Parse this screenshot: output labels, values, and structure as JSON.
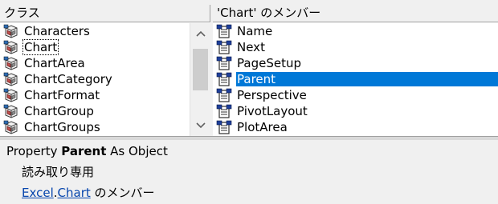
{
  "classes_pane": {
    "header": "クラス",
    "items": [
      {
        "label": "Characters"
      },
      {
        "label": "Chart"
      },
      {
        "label": "ChartArea"
      },
      {
        "label": "ChartCategory"
      },
      {
        "label": "ChartFormat"
      },
      {
        "label": "ChartGroup"
      },
      {
        "label": "ChartGroups"
      }
    ],
    "focused_index": 1
  },
  "members_pane": {
    "header": "'Chart' のメンバー",
    "items": [
      {
        "label": "Name"
      },
      {
        "label": "Next"
      },
      {
        "label": "PageSetup"
      },
      {
        "label": "Parent"
      },
      {
        "label": "Perspective"
      },
      {
        "label": "PivotLayout"
      },
      {
        "label": "PlotArea"
      }
    ],
    "selected_index": 3
  },
  "details": {
    "prefix": "Property ",
    "member_name": "Parent",
    "suffix": " As Object",
    "readonly_note": "読み取り専用",
    "library_link": "Excel",
    "dot": ".",
    "class_link": "Chart",
    "member_of": " のメンバー"
  },
  "colors": {
    "selection": "#0078d7",
    "link": "#0645ad"
  },
  "icons": {
    "class_icon": "class-module-icon",
    "member_icon": "property-icon"
  }
}
